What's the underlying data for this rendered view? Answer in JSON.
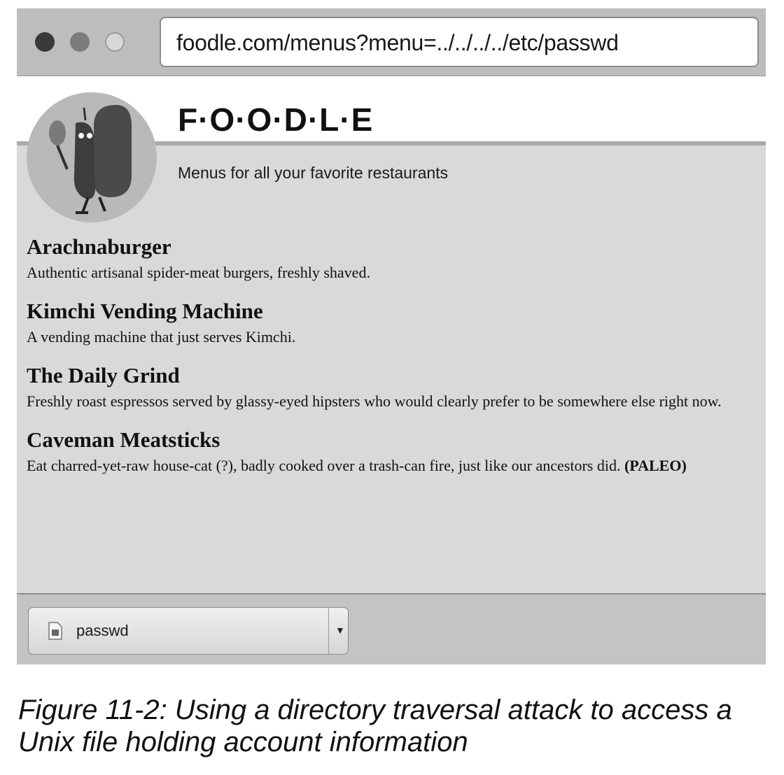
{
  "browser": {
    "url": "foodle.com/menus?menu=../../../../etc/passwd"
  },
  "site": {
    "title": "F·O·O·D·L·E",
    "tagline": "Menus for all your favorite restaurants"
  },
  "restaurants": [
    {
      "name": "Arachnaburger",
      "description": "Authentic artisanal spider-meat burgers, freshly shaved."
    },
    {
      "name": "Kimchi Vending Machine",
      "description": "A vending machine that just serves Kimchi."
    },
    {
      "name": "The Daily Grind",
      "description": "Freshly roast espressos served by glassy-eyed hipsters who would clearly prefer to be somewhere else right now."
    },
    {
      "name": "Caveman Meatsticks",
      "description": "Eat charred-yet-raw house-cat (?), badly cooked over a trash-can fire, just like our ancestors did.",
      "tag": "(PALEO)"
    }
  ],
  "download": {
    "filename": "passwd",
    "icon": "document-icon"
  },
  "caption": "Figure 11-2: Using a directory traversal attack to access a Unix file holding account information"
}
